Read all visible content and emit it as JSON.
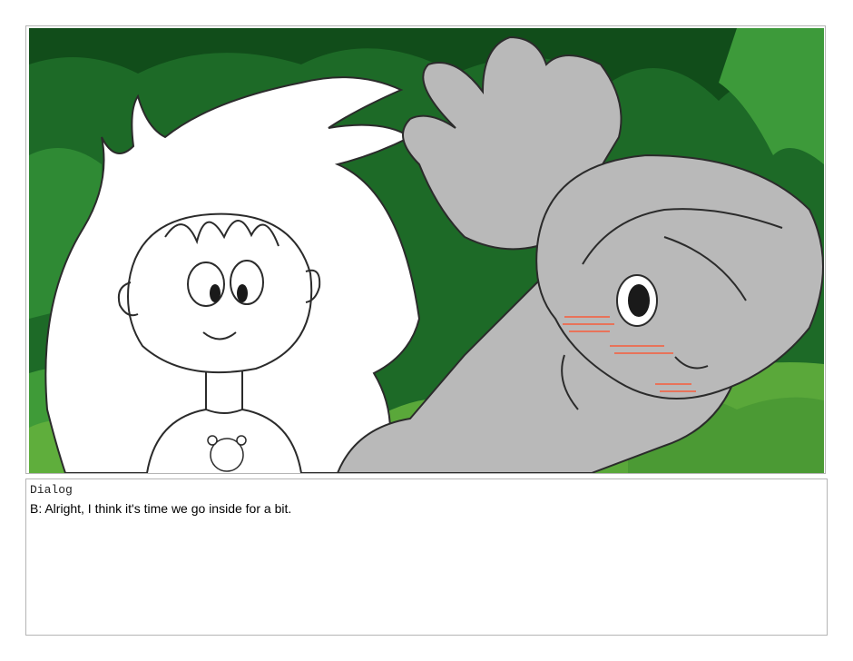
{
  "panel": {
    "image_alt": "Storyboard panel: a white-haired child with a bear shirt and a gray-shaded character lying in green grass",
    "background_color": "#1f6b2a",
    "grass_color": "#5fae3c",
    "blush_color": "#e8735a"
  },
  "dialog": {
    "label": "Dialog",
    "text": "B: Alright, I think it's time we go inside for a bit."
  }
}
